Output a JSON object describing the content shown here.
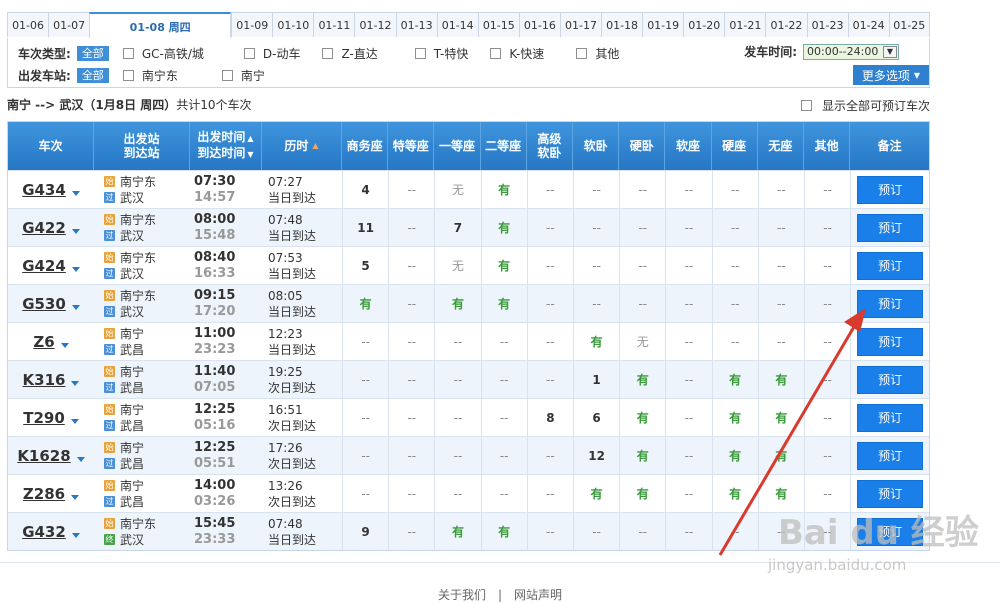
{
  "date_tabs": [
    "01-06",
    "01-07",
    "01-08 周四",
    "01-09",
    "01-10",
    "01-11",
    "01-12",
    "01-13",
    "01-14",
    "01-15",
    "01-16",
    "01-17",
    "01-18",
    "01-19",
    "01-20",
    "01-21",
    "01-22",
    "01-23",
    "01-24",
    "01-25"
  ],
  "active_tab_index": 2,
  "filters": {
    "train_type_label": "车次类型:",
    "all_label": "全部",
    "train_types": [
      "GC-高铁/城",
      "D-动车",
      "Z-直达",
      "T-特快",
      "K-快速",
      "其他"
    ],
    "station_label": "出发车站:",
    "stations": [
      "南宁东",
      "南宁"
    ],
    "time_label": "发车时间:",
    "time_value": "00:00--24:00",
    "more_label": "更多选项"
  },
  "summary": {
    "route": "南宁  --> 武汉",
    "date": "（1月8日  周四）",
    "count": "共计10个车次",
    "show_all_label": "显示全部可预订车次"
  },
  "headers": {
    "train": "车次",
    "stations": [
      "出发站",
      "到达站"
    ],
    "times": [
      "出发时间",
      "到达时间"
    ],
    "duration": "历时",
    "seats": [
      "商务座",
      "特等座",
      "一等座",
      "二等座",
      "高级软卧",
      "软卧",
      "硬卧",
      "软座",
      "硬座",
      "无座",
      "其他"
    ],
    "remark": "备注"
  },
  "book_label": "预订",
  "trains": [
    {
      "no": "G434",
      "from": "南宁东",
      "to": "武汉",
      "from_badge": "始",
      "to_badge": "过",
      "dep": "07:30",
      "arr": "14:57",
      "dur": "07:27",
      "day": "当日到达",
      "seats": [
        "4",
        "--",
        "无",
        "有",
        "--",
        "--",
        "--",
        "--",
        "--",
        "--",
        "--"
      ]
    },
    {
      "no": "G422",
      "from": "南宁东",
      "to": "武汉",
      "from_badge": "始",
      "to_badge": "过",
      "dep": "08:00",
      "arr": "15:48",
      "dur": "07:48",
      "day": "当日到达",
      "seats": [
        "11",
        "--",
        "7",
        "有",
        "--",
        "--",
        "--",
        "--",
        "--",
        "--",
        "--"
      ]
    },
    {
      "no": "G424",
      "from": "南宁东",
      "to": "武汉",
      "from_badge": "始",
      "to_badge": "过",
      "dep": "08:40",
      "arr": "16:33",
      "dur": "07:53",
      "day": "当日到达",
      "seats": [
        "5",
        "--",
        "无",
        "有",
        "--",
        "--",
        "--",
        "--",
        "--",
        "--",
        "--"
      ]
    },
    {
      "no": "G530",
      "from": "南宁东",
      "to": "武汉",
      "from_badge": "始",
      "to_badge": "过",
      "dep": "09:15",
      "arr": "17:20",
      "dur": "08:05",
      "day": "当日到达",
      "seats": [
        "有",
        "--",
        "有",
        "有",
        "--",
        "--",
        "--",
        "--",
        "--",
        "--",
        "--"
      ]
    },
    {
      "no": "Z6",
      "from": "南宁",
      "to": "武昌",
      "from_badge": "始",
      "to_badge": "过",
      "dep": "11:00",
      "arr": "23:23",
      "dur": "12:23",
      "day": "当日到达",
      "seats": [
        "--",
        "--",
        "--",
        "--",
        "--",
        "有",
        "无",
        "--",
        "--",
        "--",
        "--"
      ]
    },
    {
      "no": "K316",
      "from": "南宁",
      "to": "武昌",
      "from_badge": "始",
      "to_badge": "过",
      "dep": "11:40",
      "arr": "07:05",
      "dur": "19:25",
      "day": "次日到达",
      "seats": [
        "--",
        "--",
        "--",
        "--",
        "--",
        "1",
        "有",
        "--",
        "有",
        "有",
        "--"
      ]
    },
    {
      "no": "T290",
      "from": "南宁",
      "to": "武昌",
      "from_badge": "始",
      "to_badge": "过",
      "dep": "12:25",
      "arr": "05:16",
      "dur": "16:51",
      "day": "次日到达",
      "seats": [
        "--",
        "--",
        "--",
        "--",
        "8",
        "6",
        "有",
        "--",
        "有",
        "有",
        "--"
      ]
    },
    {
      "no": "K1628",
      "from": "南宁",
      "to": "武昌",
      "from_badge": "始",
      "to_badge": "过",
      "dep": "12:25",
      "arr": "05:51",
      "dur": "17:26",
      "day": "次日到达",
      "seats": [
        "--",
        "--",
        "--",
        "--",
        "--",
        "12",
        "有",
        "--",
        "有",
        "有",
        "--"
      ]
    },
    {
      "no": "Z286",
      "from": "南宁",
      "to": "武昌",
      "from_badge": "始",
      "to_badge": "过",
      "dep": "14:00",
      "arr": "03:26",
      "dur": "13:26",
      "day": "次日到达",
      "seats": [
        "--",
        "--",
        "--",
        "--",
        "--",
        "有",
        "有",
        "--",
        "有",
        "有",
        "--"
      ]
    },
    {
      "no": "G432",
      "from": "南宁东",
      "to": "武汉",
      "from_badge": "始",
      "to_badge": "终",
      "dep": "15:45",
      "arr": "23:33",
      "dur": "07:48",
      "day": "当日到达",
      "seats": [
        "9",
        "--",
        "有",
        "有",
        "--",
        "--",
        "--",
        "--",
        "--",
        "--",
        "--"
      ]
    }
  ],
  "footer": {
    "about": "关于我们",
    "sep": "|",
    "statement": "网站声明"
  },
  "watermark": {
    "text": "Bai du 经验",
    "url": "jingyan.baidu.com"
  }
}
